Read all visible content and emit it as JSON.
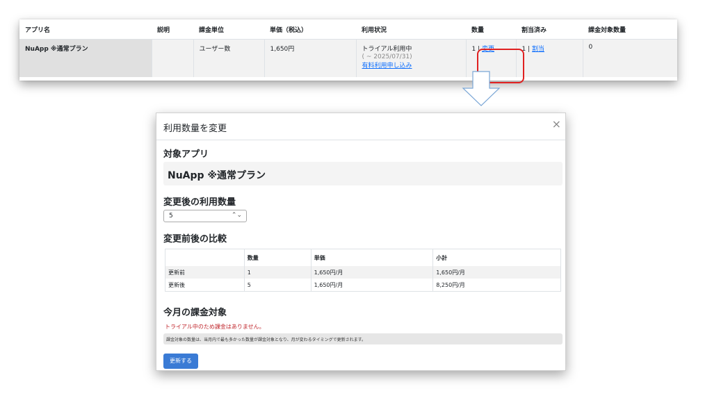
{
  "apps_table": {
    "headers": [
      "アプリ名",
      "説明",
      "課金単位",
      "単価（税込）",
      "利用状況",
      "数量",
      "割当済み",
      "課金対象数量"
    ],
    "row": {
      "app_name": "NuApp ※通常プラン",
      "description": "",
      "billing_unit": "ユーザー数",
      "unit_price": "1,650円",
      "status": "トライアル利用中",
      "status_period": "( ~ 2025/07/31)",
      "paid_link": "有料利用申し込み",
      "quantity": "1 |",
      "quantity_link": "変更",
      "assigned": "1 |",
      "assigned_link": "割当",
      "billable_quantity": "0"
    }
  },
  "modal": {
    "title": "利用数量を変更",
    "close_glyph": "×",
    "target_app_heading": "対象アプリ",
    "target_app_name": "NuApp ※通常プラン",
    "new_quantity_heading": "変更後の利用数量",
    "new_quantity_value": "5",
    "select_arrow_glyph": "⌃⌄",
    "comparison_heading": "変更前後の比較",
    "comparison": {
      "headers": [
        "",
        "数量",
        "単価",
        "小計"
      ],
      "rows": [
        [
          "更新前",
          "1",
          "1,650円/月",
          "1,650円/月"
        ],
        [
          "更新後",
          "5",
          "1,650円/月",
          "8,250円/月"
        ]
      ]
    },
    "billing_heading": "今月の課金対象",
    "trial_warning": "トライアル中のため課金はありません。",
    "billing_note": "課金対象の数量は、当月内で最も多かった数量が課金対象となり、月が変わるタイミングで更新されます。",
    "update_button": "更新する"
  },
  "colors": {
    "highlight": "#e02020",
    "link": "#0d6efd",
    "warning": "#c0282e",
    "button": "#3a7bd5",
    "arrow": "#7aa6d6"
  }
}
